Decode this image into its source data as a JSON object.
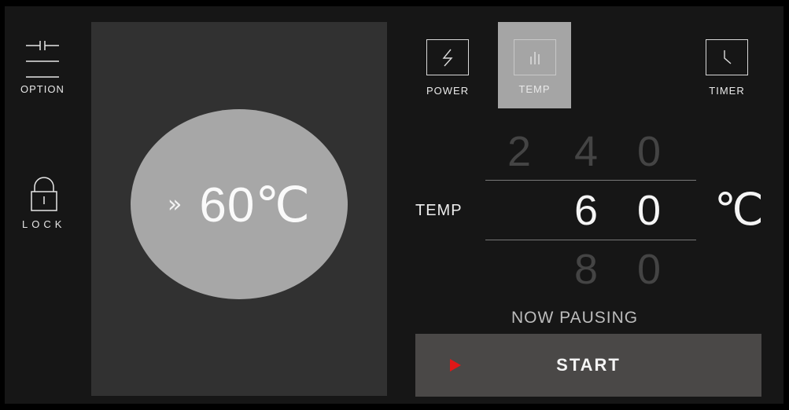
{
  "sidebar": {
    "option_label": "OPTION",
    "lock_label": "LOCK"
  },
  "preview": {
    "chevron": "»",
    "temperature": "60℃"
  },
  "modes": [
    {
      "label": "POWER",
      "icon": "lightning-icon",
      "active": false
    },
    {
      "label": "TEMP",
      "icon": "bars-icon",
      "active": true
    },
    {
      "label": "TIMER",
      "icon": "clock-icon",
      "active": false
    }
  ],
  "temp_picker": {
    "label": "TEMP",
    "prev": [
      "2",
      "4",
      "0"
    ],
    "current": [
      "6",
      "0"
    ],
    "next": [
      "8",
      "0"
    ],
    "unit": "℃"
  },
  "status": "NOW PAUSING",
  "start_button": {
    "label": "START",
    "icon": "play-icon",
    "icon_color": "#e01818"
  },
  "colors": {
    "background": "#161616",
    "panel": "#313131",
    "oval": "#a7a7a7",
    "active_mode": "#a5a5a5",
    "start_bg": "#4a4847"
  }
}
